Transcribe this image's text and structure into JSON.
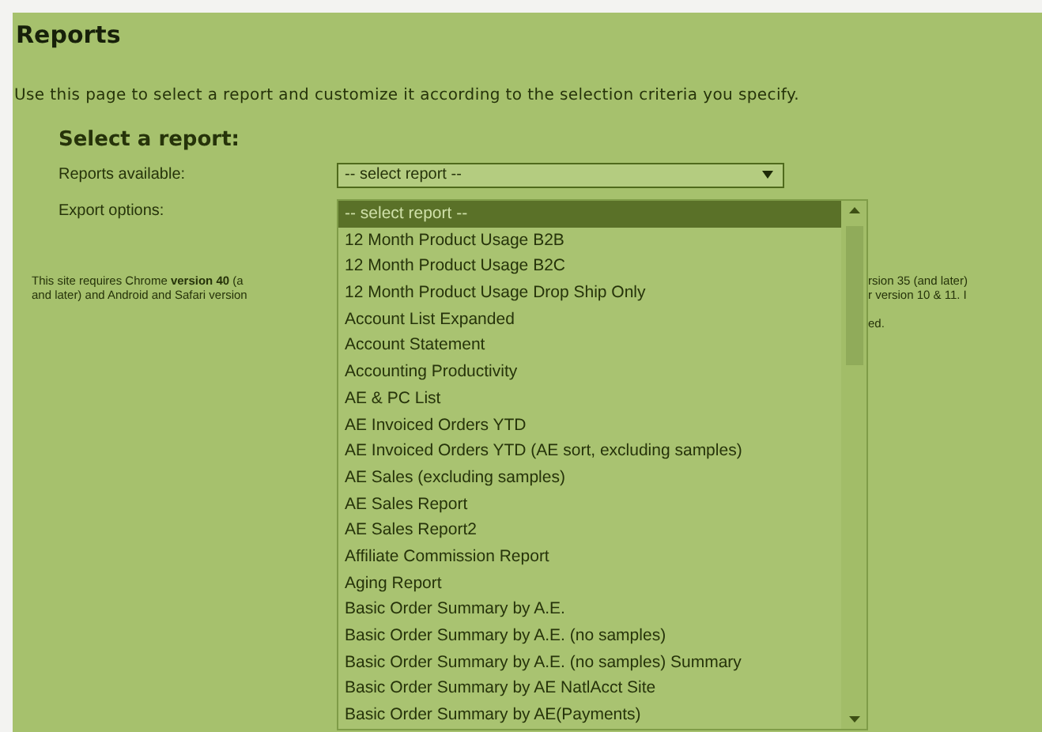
{
  "page": {
    "title": "Reports",
    "description": "Use this page to select a report and customize it according to the selection criteria you specify."
  },
  "form": {
    "heading": "Select a report:",
    "fields": [
      {
        "label": "Reports available:",
        "kind": "select",
        "value": "-- select report --"
      },
      {
        "label": "Export options:",
        "kind": "text"
      }
    ]
  },
  "notice": {
    "left_lines": [
      "This site requires Chrome **version 40** (a",
      "and later) and Android and Safari version"
    ],
    "right_lines": [
      "rsion 35 (and later)",
      "r version 10 & 11. I"
    ],
    "right_tail": "ed."
  },
  "dropdown": {
    "options": [
      {
        "label": "-- select report --",
        "selected": true
      },
      {
        "label": "12 Month Product Usage B2B",
        "selected": false
      },
      {
        "label": "12 Month Product Usage B2C",
        "selected": false
      },
      {
        "label": "12 Month Product Usage Drop Ship Only",
        "selected": false
      },
      {
        "label": "Account List Expanded",
        "selected": false
      },
      {
        "label": "Account Statement",
        "selected": false
      },
      {
        "label": "Accounting Productivity",
        "selected": false
      },
      {
        "label": "AE & PC List",
        "selected": false
      },
      {
        "label": "AE Invoiced Orders YTD",
        "selected": false
      },
      {
        "label": "AE Invoiced Orders YTD (AE sort, excluding samples)",
        "selected": false
      },
      {
        "label": "AE Sales (excluding samples)",
        "selected": false
      },
      {
        "label": "AE Sales Report",
        "selected": false
      },
      {
        "label": "AE Sales Report2",
        "selected": false
      },
      {
        "label": "Affiliate Commission Report",
        "selected": false
      },
      {
        "label": "Aging Report",
        "selected": false
      },
      {
        "label": "Basic Order Summary by A.E.",
        "selected": false
      },
      {
        "label": "Basic Order Summary by A.E. (no samples)",
        "selected": false
      },
      {
        "label": "Basic Order Summary by A.E. (no samples) Summary",
        "selected": false
      },
      {
        "label": "Basic Order Summary by AE NatlAcct Site",
        "selected": false
      },
      {
        "label": "Basic Order Summary by AE(Payments)",
        "selected": false
      }
    ]
  }
}
